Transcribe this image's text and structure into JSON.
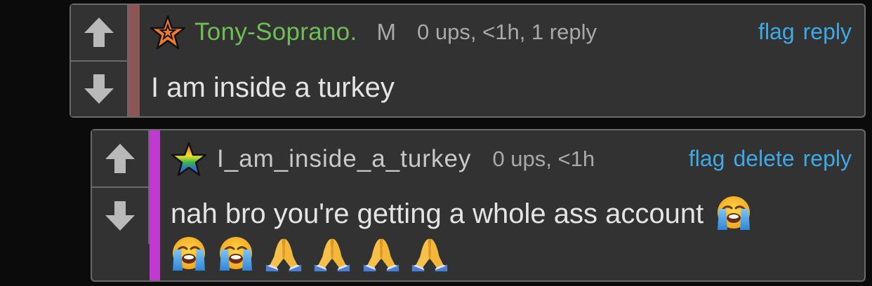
{
  "comments": [
    {
      "username": "Tony-Soprano.",
      "flair": "M",
      "meta": "0 ups, <1h, 1 reply",
      "actions": [
        "flag",
        "reply"
      ],
      "text": "I am inside a turkey",
      "stripe_color": "#8c5656",
      "username_color": "#6fbe55",
      "badge_icon": "orange-star-icon"
    },
    {
      "username": "I_am_inside_a_turkey",
      "meta": "0 ups, <1h",
      "actions": [
        "flag",
        "delete",
        "reply"
      ],
      "text": "nah bro you're getting a whole ass account",
      "emojis_inline": [
        "loudly-crying-face"
      ],
      "emojis_line2": [
        "loudly-crying-face",
        "loudly-crying-face",
        "folded-hands",
        "folded-hands",
        "folded-hands",
        "folded-hands"
      ],
      "stripe_color": "#c03ad0",
      "username_color": "#c9c9c9",
      "badge_icon": "rainbow-star-icon"
    }
  ],
  "colors": {
    "background": "#0b0b0b",
    "panel": "#323232",
    "border": "#6a6a6a",
    "link": "#3fa9e6",
    "meta": "#a9a9a9",
    "body_text": "#e4e4e4"
  }
}
